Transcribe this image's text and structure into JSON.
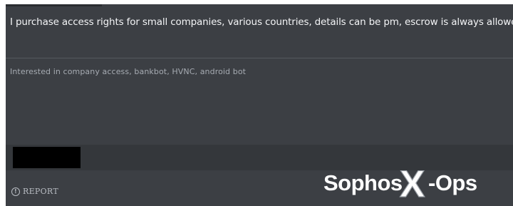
{
  "post": {
    "message": "I purchase access rights for small companies, various countries, details can be pm, escrow is always allowed",
    "signature": "Interested in company access, bankbot,  HVNC,  android bot"
  },
  "footer": {
    "report_label": "REPORT",
    "report_icon": "alert-circle-icon"
  },
  "watermark": {
    "brand": "Sophos",
    "mark": "X",
    "suffix": "-Ops"
  },
  "colors": {
    "panel": "#3c3f44",
    "footer_band": "#34373b",
    "text": "#f3f4f6",
    "muted_text": "#a6abb2"
  }
}
